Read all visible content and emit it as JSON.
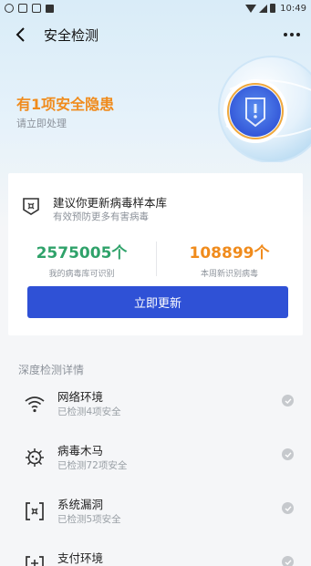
{
  "status_bar": {
    "time": "10:49"
  },
  "header": {
    "title": "安全检测"
  },
  "summary": {
    "title": "有1项安全隐患",
    "subtitle": "请立即处理"
  },
  "card": {
    "title": "建议你更新病毒样本库",
    "subtitle": "有效预防更多有害病毒",
    "stats": [
      {
        "value": "2575005个",
        "label": "我的病毒库可识别"
      },
      {
        "value": "108899个",
        "label": "本周新识别病毒"
      }
    ],
    "button_label": "立即更新"
  },
  "details": {
    "heading": "深度检测详情",
    "items": [
      {
        "title": "网络环境",
        "subtitle": "已检测4项安全",
        "icon": "wifi-icon"
      },
      {
        "title": "病毒木马",
        "subtitle": "已检测72项安全",
        "icon": "virus-icon"
      },
      {
        "title": "系统漏洞",
        "subtitle": "已检测5项安全",
        "icon": "system-vulnerability-icon"
      },
      {
        "title": "支付环境",
        "subtitle": "",
        "icon": "payment-icon"
      }
    ]
  },
  "colors": {
    "accent": "#2f51d6",
    "warning": "#f08b1c",
    "success": "#2fa26a"
  }
}
